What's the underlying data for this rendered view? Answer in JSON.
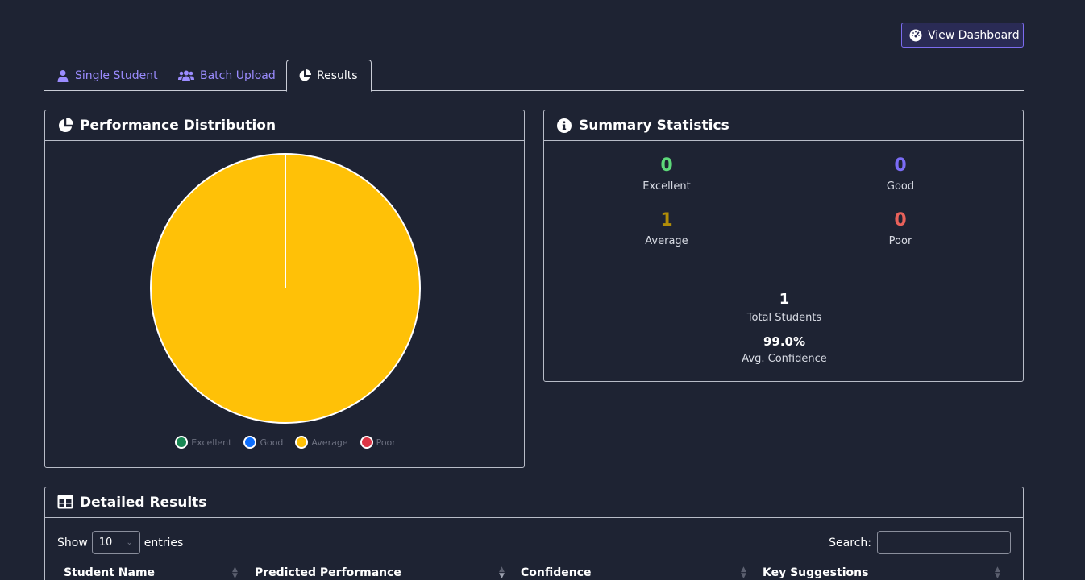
{
  "header": {
    "dashboard_button": "View Dashboard"
  },
  "tabs": [
    {
      "label": "Single Student",
      "icon": "user-icon",
      "active": false
    },
    {
      "label": "Batch Upload",
      "icon": "users-icon",
      "active": false
    },
    {
      "label": "Results",
      "icon": "pie-chart-icon",
      "active": true
    }
  ],
  "performance": {
    "title": "Performance Distribution",
    "chart_data": {
      "type": "pie",
      "categories": [
        "Excellent",
        "Good",
        "Average",
        "Poor"
      ],
      "values": [
        0,
        0,
        1,
        0
      ],
      "colors": [
        "#198754",
        "#0d6efd",
        "#ffc107",
        "#dc3545"
      ],
      "legend_position": "bottom"
    }
  },
  "summary": {
    "title": "Summary Statistics",
    "excellent": {
      "value": "0",
      "label": "Excellent",
      "color": "#5dd879"
    },
    "good": {
      "value": "0",
      "label": "Good",
      "color": "#7b6cf6"
    },
    "average": {
      "value": "1",
      "label": "Average",
      "color": "#b18d08"
    },
    "poor": {
      "value": "0",
      "label": "Poor",
      "color": "#e8615a"
    },
    "total": {
      "value": "1",
      "label": "Total Students"
    },
    "confidence": {
      "value": "99.0%",
      "label": "Avg. Confidence"
    }
  },
  "details": {
    "title": "Detailed Results",
    "show_label": "Show",
    "entries_value": "10",
    "entries_label": "entries",
    "search_label": "Search:",
    "search_value": "",
    "columns": [
      "Student Name",
      "Predicted Performance",
      "Confidence",
      "Key Suggestions"
    ]
  }
}
